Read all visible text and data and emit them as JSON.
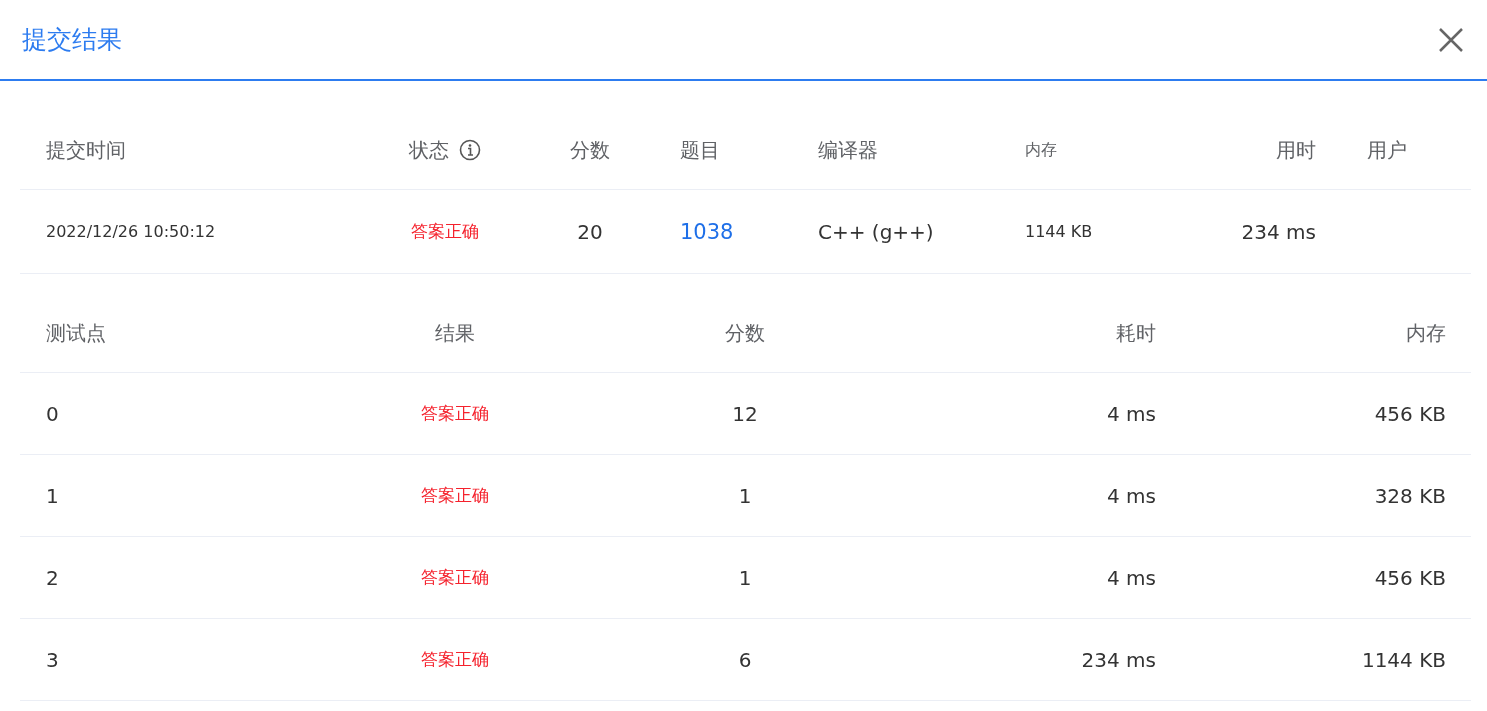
{
  "dialog": {
    "title": "提交结果"
  },
  "submission": {
    "columns": [
      {
        "label": "提交时间",
        "compact": false,
        "info": false
      },
      {
        "label": "状态",
        "compact": false,
        "info": true
      },
      {
        "label": "分数",
        "compact": false,
        "info": false
      },
      {
        "label": "题目",
        "compact": false,
        "info": false
      },
      {
        "label": "编译器",
        "compact": false,
        "info": false
      },
      {
        "label": "内存",
        "compact": true,
        "info": false
      },
      {
        "label": "用时",
        "compact": false,
        "info": false
      },
      {
        "label": "用户",
        "compact": false,
        "info": false
      }
    ],
    "row": [
      {
        "text": "2022/12/26 10:50:12",
        "kind": "small"
      },
      {
        "text": "答案正确",
        "kind": "accepted"
      },
      {
        "text": "20",
        "kind": "plain"
      },
      {
        "text": "1038",
        "kind": "link"
      },
      {
        "text": "C++ (g++)",
        "kind": "plain"
      },
      {
        "text": "1144 KB",
        "kind": "small"
      },
      {
        "text": "234 ms",
        "kind": "plain"
      }
    ]
  },
  "testcases": {
    "columns": [
      "测试点",
      "结果",
      "分数",
      "耗时",
      "内存"
    ],
    "rows": [
      {
        "case": "0",
        "result": {
          "text": "答案正确",
          "kind": "accepted"
        },
        "score": "12",
        "time": "4 ms",
        "memory": "456 KB"
      },
      {
        "case": "1",
        "result": {
          "text": "答案正确",
          "kind": "accepted"
        },
        "score": "1",
        "time": "4 ms",
        "memory": "328 KB"
      },
      {
        "case": "2",
        "result": {
          "text": "答案正确",
          "kind": "accepted"
        },
        "score": "1",
        "time": "4 ms",
        "memory": "456 KB"
      },
      {
        "case": "3",
        "result": {
          "text": "答案正确",
          "kind": "accepted"
        },
        "score": "6",
        "time": "234 ms",
        "memory": "1144 KB"
      }
    ]
  }
}
